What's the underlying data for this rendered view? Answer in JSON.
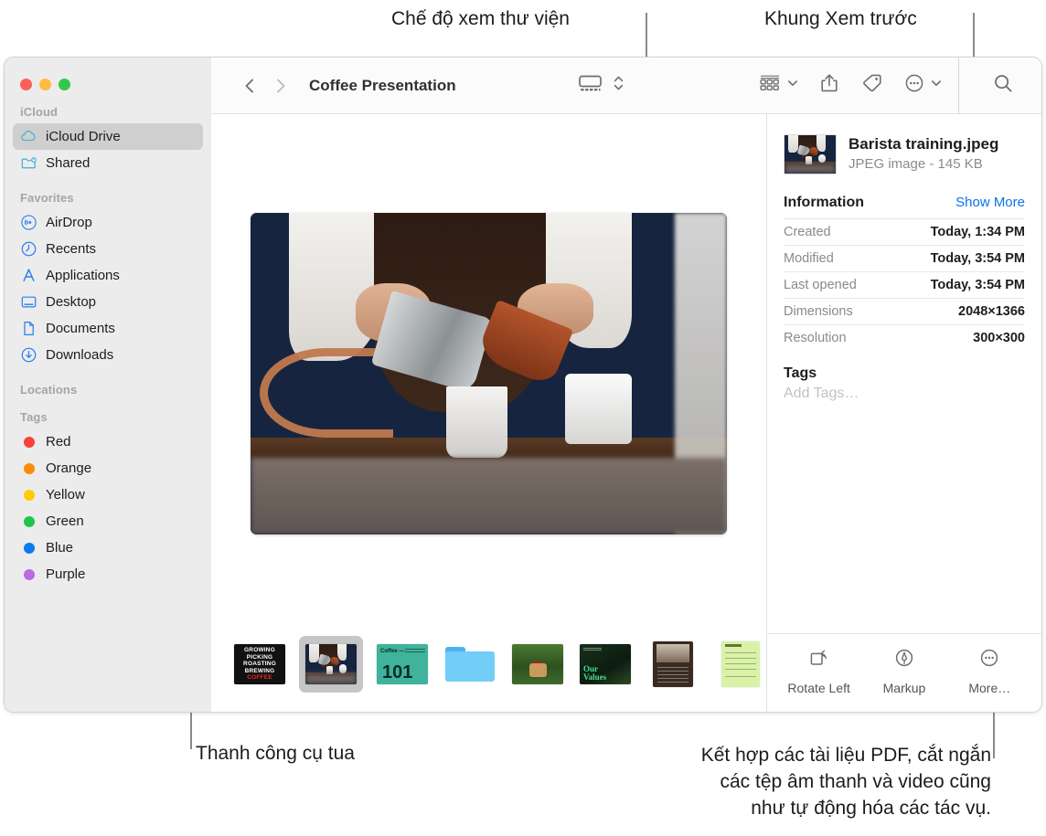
{
  "callouts": {
    "gallery_view": "Chế độ xem thư viện",
    "preview_pane": "Khung Xem trước",
    "toolbar": "Thanh công cụ tua",
    "bottom_right": "Kết hợp các tài liệu PDF, cắt ngắn\ncác tệp âm thanh và video cũng\nnhư tự động hóa các tác vụ."
  },
  "window": {
    "title": "Coffee Presentation",
    "traffic_lights": [
      "close-red",
      "minimize-yellow",
      "zoom-green"
    ]
  },
  "toolbar": {
    "back_icon": "chevron-left-icon",
    "forward_icon": "chevron-right-icon",
    "view_gallery_icon": "gallery-view-icon",
    "view_stepper_icon": "up-down-chevron-icon",
    "group_icon": "group-items-icon",
    "group_chevron": "chevron-down-icon",
    "share_icon": "share-icon",
    "tag_icon": "tag-icon",
    "more_icon": "ellipsis-circle-icon",
    "more_chevron": "chevron-down-icon",
    "search_icon": "search-icon"
  },
  "sidebar": {
    "sections": [
      {
        "title": "iCloud",
        "items": [
          {
            "label": "iCloud Drive",
            "icon": "icloud-icon",
            "active": true
          },
          {
            "label": "Shared",
            "icon": "shared-folder-icon",
            "active": false
          }
        ]
      },
      {
        "title": "Favorites",
        "items": [
          {
            "label": "AirDrop",
            "icon": "airdrop-icon",
            "active": false
          },
          {
            "label": "Recents",
            "icon": "clock-icon",
            "active": false
          },
          {
            "label": "Applications",
            "icon": "applications-icon",
            "active": false
          },
          {
            "label": "Desktop",
            "icon": "desktop-icon",
            "active": false
          },
          {
            "label": "Documents",
            "icon": "document-icon",
            "active": false
          },
          {
            "label": "Downloads",
            "icon": "downloads-icon",
            "active": false
          }
        ]
      },
      {
        "title": "Locations",
        "items": []
      },
      {
        "title": "Tags",
        "items": [
          {
            "label": "Red",
            "icon": "tag-dot",
            "color": "#f9423a"
          },
          {
            "label": "Orange",
            "icon": "tag-dot",
            "color": "#f98c0a"
          },
          {
            "label": "Yellow",
            "icon": "tag-dot",
            "color": "#ffcc00"
          },
          {
            "label": "Green",
            "icon": "tag-dot",
            "color": "#21c44a"
          },
          {
            "label": "Blue",
            "icon": "tag-dot",
            "color": "#0a7cf1"
          },
          {
            "label": "Purple",
            "icon": "tag-dot",
            "color": "#bb6ae0"
          }
        ]
      }
    ]
  },
  "preview": {
    "hero_alt": "barista pouring milk into paper cup",
    "thumbnails": [
      {
        "name": "coffee-poster",
        "kind": "poster",
        "selected": false
      },
      {
        "name": "barista-training-jpeg",
        "kind": "photo",
        "selected": true
      },
      {
        "name": "coffee-101-slide",
        "kind": "slide101",
        "selected": false
      },
      {
        "name": "folder",
        "kind": "folder",
        "selected": false
      },
      {
        "name": "berries-photo",
        "kind": "berries",
        "selected": false
      },
      {
        "name": "our-values-slide",
        "kind": "values",
        "selected": false
      },
      {
        "name": "meeting-brochure",
        "kind": "brochure",
        "selected": false
      },
      {
        "name": "receipt-document",
        "kind": "receipt",
        "selected": false
      }
    ]
  },
  "info": {
    "file_name": "Barista training.jpeg",
    "file_meta": "JPEG image - 145 KB",
    "section_title": "Information",
    "show_more": "Show More",
    "rows": [
      {
        "key": "Created",
        "value": "Today, 1:34 PM"
      },
      {
        "key": "Modified",
        "value": "Today, 3:54 PM"
      },
      {
        "key": "Last opened",
        "value": "Today, 3:54 PM"
      },
      {
        "key": "Dimensions",
        "value": "2048×1366"
      },
      {
        "key": "Resolution",
        "value": "300×300"
      }
    ],
    "tags_title": "Tags",
    "tags_placeholder": "Add Tags…",
    "actions": [
      {
        "label": "Rotate Left",
        "icon": "rotate-left-icon"
      },
      {
        "label": "Markup",
        "icon": "markup-icon"
      },
      {
        "label": "More…",
        "icon": "ellipsis-circle-icon"
      }
    ]
  },
  "colors": {
    "accent_link": "#0a73e8",
    "sidebar_bg": "#ececec",
    "selection": "#cfcfcf"
  }
}
